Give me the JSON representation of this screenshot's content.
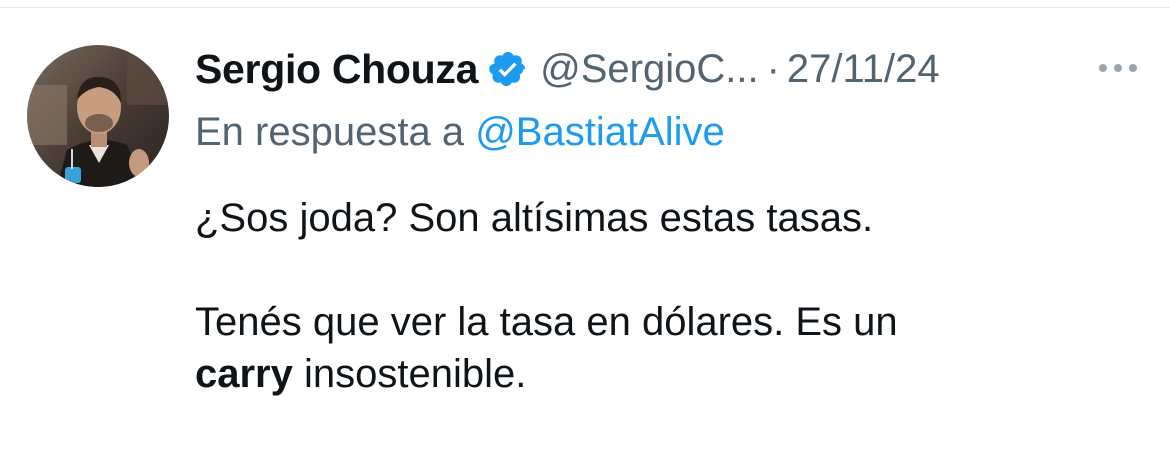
{
  "tweet": {
    "author": {
      "display_name": "Sergio Chouza",
      "handle": "@SergioC...",
      "verified": true,
      "avatar_icon": "profile-photo"
    },
    "separator": "·",
    "date": "27/11/24",
    "more_icon": "more-options-icon",
    "reply": {
      "prefix": "En respuesta a",
      "mention": "@BastiatAlive"
    },
    "body": {
      "paragraph1": "¿Sos joda? Son altísimas estas tasas.",
      "paragraph2_line1": "Tenés que ver la tasa en dólares. Es un",
      "paragraph2_bold": "carry",
      "paragraph2_rest": " insostenible."
    }
  },
  "colors": {
    "text_primary": "#0f1419",
    "text_secondary": "#536471",
    "accent_blue": "#1d9bf0",
    "divider": "#e6e9eb"
  }
}
